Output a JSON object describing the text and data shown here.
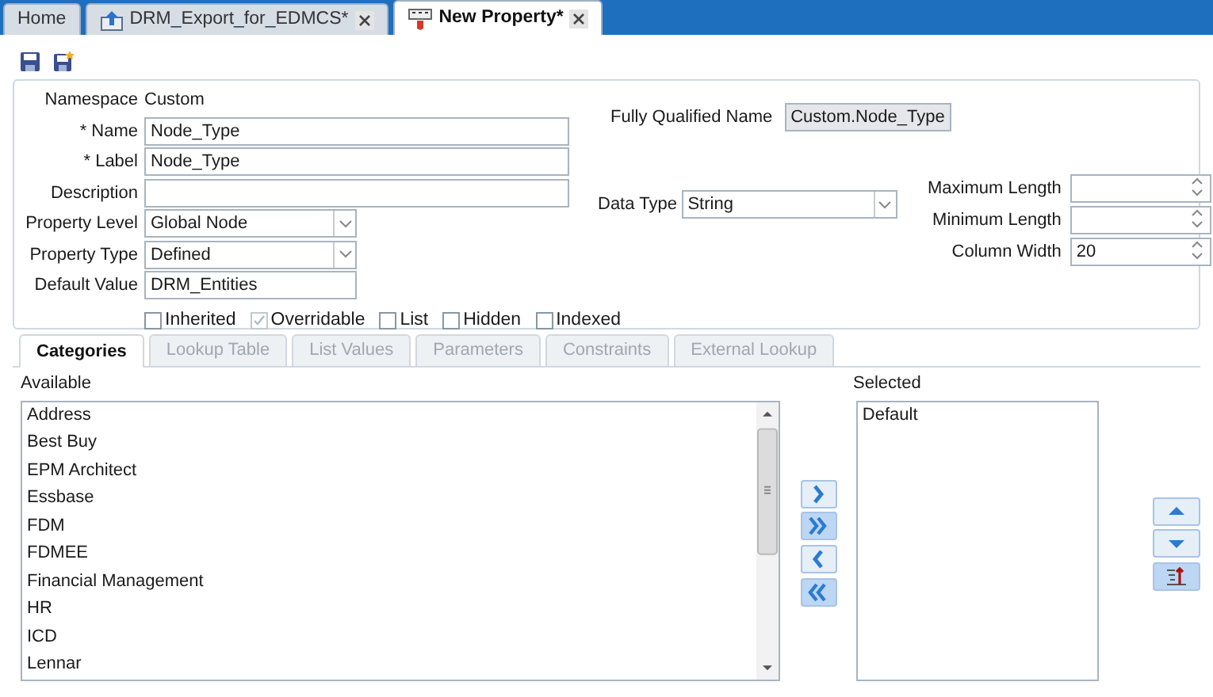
{
  "tabs": [
    {
      "label": "Home",
      "kind": "plain",
      "closable": false,
      "selected": false
    },
    {
      "label": "DRM_Export_for_EDMCS*",
      "kind": "export",
      "closable": true,
      "selected": false
    },
    {
      "label": "New Property*",
      "kind": "property",
      "closable": true,
      "selected": true
    }
  ],
  "form": {
    "left_fields": [
      {
        "label": "Namespace",
        "kind": "static",
        "value": "Custom"
      },
      {
        "label": "* Name",
        "kind": "wide_text",
        "value": "Node_Type"
      },
      {
        "label": "* Label",
        "kind": "wide_text",
        "value": "Node_Type"
      },
      {
        "label": "Description",
        "kind": "wide_text"
      },
      {
        "label": "Property Level",
        "kind": "select",
        "value": "Global Node"
      },
      {
        "label": "Property Type",
        "kind": "select",
        "value": "Defined"
      },
      {
        "label": "Default Value",
        "kind": "text",
        "value": "DRM_Entities"
      }
    ],
    "fully_qualified_name": {
      "label": "Fully Qualified Name",
      "value": "Custom.Node_Type",
      "readonly": true
    },
    "data_type": {
      "label": "Data Type",
      "value": "String"
    },
    "right_fields": [
      {
        "label": "Maximum Length"
      },
      {
        "label": "Minimum Length"
      },
      {
        "label": "Column Width",
        "value": "20"
      }
    ],
    "checkboxes": [
      {
        "label": "Inherited",
        "checked": false,
        "disabled": false
      },
      {
        "label": "Overridable",
        "checked": true,
        "disabled": true
      },
      {
        "label": "List",
        "checked": false,
        "disabled": false
      },
      {
        "label": "Hidden",
        "checked": false,
        "disabled": false
      },
      {
        "label": "Indexed",
        "checked": false,
        "disabled": false
      }
    ]
  },
  "detail_tabs": [
    {
      "label": "Categories",
      "selected": true
    },
    {
      "label": "Lookup Table",
      "selected": false
    },
    {
      "label": "List Values",
      "selected": false
    },
    {
      "label": "Parameters",
      "selected": false
    },
    {
      "label": "Constraints",
      "selected": false
    },
    {
      "label": "External Lookup",
      "selected": false
    }
  ],
  "available": {
    "label": "Available",
    "items": [
      "Address",
      "Best Buy",
      "EPM Architect",
      "Essbase",
      "FDM",
      "FDMEE",
      "Financial Management",
      "HR",
      "ICD",
      "Lennar"
    ]
  },
  "selected_list": {
    "label": "Selected",
    "items": [
      "Default"
    ]
  }
}
